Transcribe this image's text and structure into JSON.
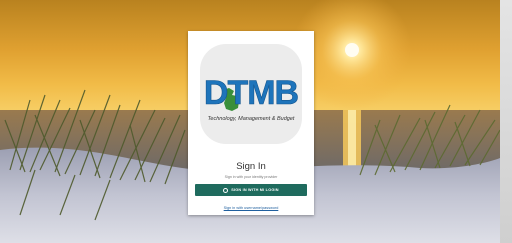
{
  "login": {
    "logo": {
      "text": "DTMB",
      "tagline": "Technology, Management & Budget"
    },
    "title": "Sign In",
    "subtitle": "Sign in with your identity provider",
    "primary_button_label": "SIGN IN WITH MI LOGIN",
    "alternate_link_label": "Sign in with username/password"
  },
  "colors": {
    "brand_blue": "#1e74bb",
    "brand_green": "#3a8f3a",
    "button_teal": "#1f6b5e"
  },
  "icons": {
    "button_icon": "person-icon",
    "logo_shape": "michigan-map-icon"
  }
}
